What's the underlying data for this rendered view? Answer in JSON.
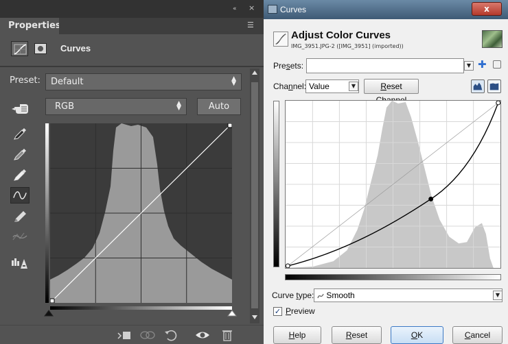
{
  "photoshop": {
    "panel_tab": "Properties",
    "collapse_glyph": "«",
    "close_glyph": "×",
    "panel_menu_glyph": "☰",
    "adjustment_title": "Curves",
    "preset_label": "Preset:",
    "preset_value": "Default",
    "channel_value": "RGB",
    "auto_label": "Auto",
    "tools": [
      "sample-black-eyedropper-icon",
      "sample-gray-eyedropper-icon",
      "sample-white-eyedropper-icon",
      "curve-points-tool-icon",
      "pencil-draw-icon",
      "smooth-curve-icon",
      "clipping-warning-icon"
    ],
    "active_tool": "curve-points-tool-icon",
    "bottom_icons": [
      "clip-to-layer-icon",
      "view-previous-state-icon",
      "reset-adjustment-icon",
      "toggle-visibility-icon",
      "delete-adjustment-icon"
    ],
    "colors": {
      "panel_bg": "#535353",
      "graph_bg": "#3b3b3b",
      "histogram": "#9a9a9a",
      "curve": "#ffffff"
    }
  },
  "gimp": {
    "window_title": "Curves",
    "close_label": "x",
    "dialog_title": "Adjust Color Curves",
    "dialog_subtitle": "IMG_3951.JPG-2 ([IMG_3951] (imported))",
    "presets_label_pre": "Pre",
    "presets_label_ul": "s",
    "presets_label_post": "ets:",
    "presets_value": "",
    "channel_label_pre": "Cha",
    "channel_label_ul": "n",
    "channel_label_post": "nel:",
    "channel_value": "Value",
    "reset_channel_pre": "R",
    "reset_channel_post": "eset Channel",
    "curve_type_pre": "Curve ",
    "curve_type_ul": "t",
    "curve_type_post": "ype:",
    "curve_type_value": "Smooth",
    "preview_checked": true,
    "preview_ul": "P",
    "preview_post": "review",
    "help_ul": "H",
    "help_post": "elp",
    "reset_ul": "R",
    "reset_post": "eset",
    "ok_ul": "O",
    "ok_post": "K",
    "cancel_ul": "C",
    "cancel_post": "ancel",
    "curve_points": [
      [
        0,
        0
      ],
      [
        0.68,
        0.41
      ],
      [
        1,
        1
      ]
    ],
    "colors": {
      "titlebar": "#4f6c88",
      "graph_bg": "#ffffff",
      "histogram": "#c8c8c8",
      "curve": "#000000",
      "ok_border": "#3b78c4"
    }
  }
}
